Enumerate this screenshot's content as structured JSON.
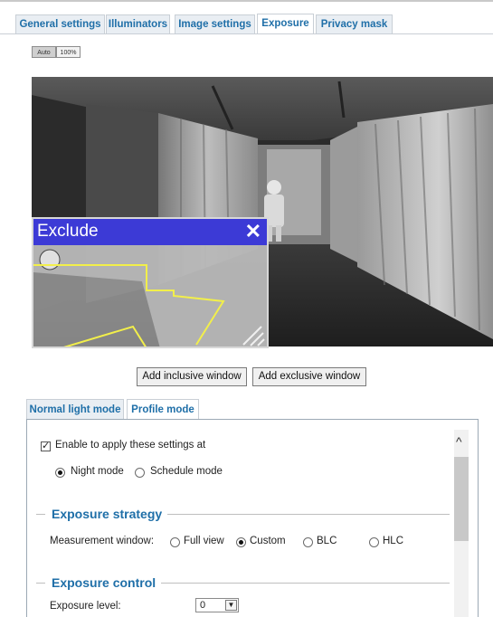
{
  "top_tabs": [
    {
      "label": "General settings"
    },
    {
      "label": "Illuminators"
    },
    {
      "label": "Image settings"
    },
    {
      "label": "Exposure"
    },
    {
      "label": "Privacy mask"
    }
  ],
  "active_top_tab": "Exposure",
  "zoom": {
    "auto_label": "Auto",
    "full_label": "100%"
  },
  "exclude_window": {
    "title": "Exclude",
    "close_glyph": "✕"
  },
  "buttons": {
    "add_inclusive": "Add inclusive window",
    "add_exclusive": "Add exclusive window"
  },
  "sub_tabs": [
    {
      "label": "Normal light mode"
    },
    {
      "label": "Profile mode"
    }
  ],
  "active_sub_tab": "Normal light mode",
  "profile": {
    "enable_label": "Enable to apply these settings at",
    "enable_checked": true,
    "night_mode_label": "Night mode",
    "schedule_mode_label": "Schedule mode",
    "selected_mode": "Night mode"
  },
  "exposure_strategy": {
    "title": "Exposure strategy",
    "measurement_label": "Measurement window:",
    "options": [
      "Full view",
      "Custom",
      "BLC",
      "HLC"
    ],
    "selected": "Custom"
  },
  "exposure_control": {
    "title": "Exposure control",
    "level_label": "Exposure level:",
    "level_value": "0",
    "dropdown_glyph": "▼"
  },
  "colors": {
    "tab_text": "#1f6fa8",
    "exclude_bar": "#3c3ad6",
    "exclude_outline": "#f2ef4a"
  },
  "icons": {
    "scroll_up": "^"
  }
}
